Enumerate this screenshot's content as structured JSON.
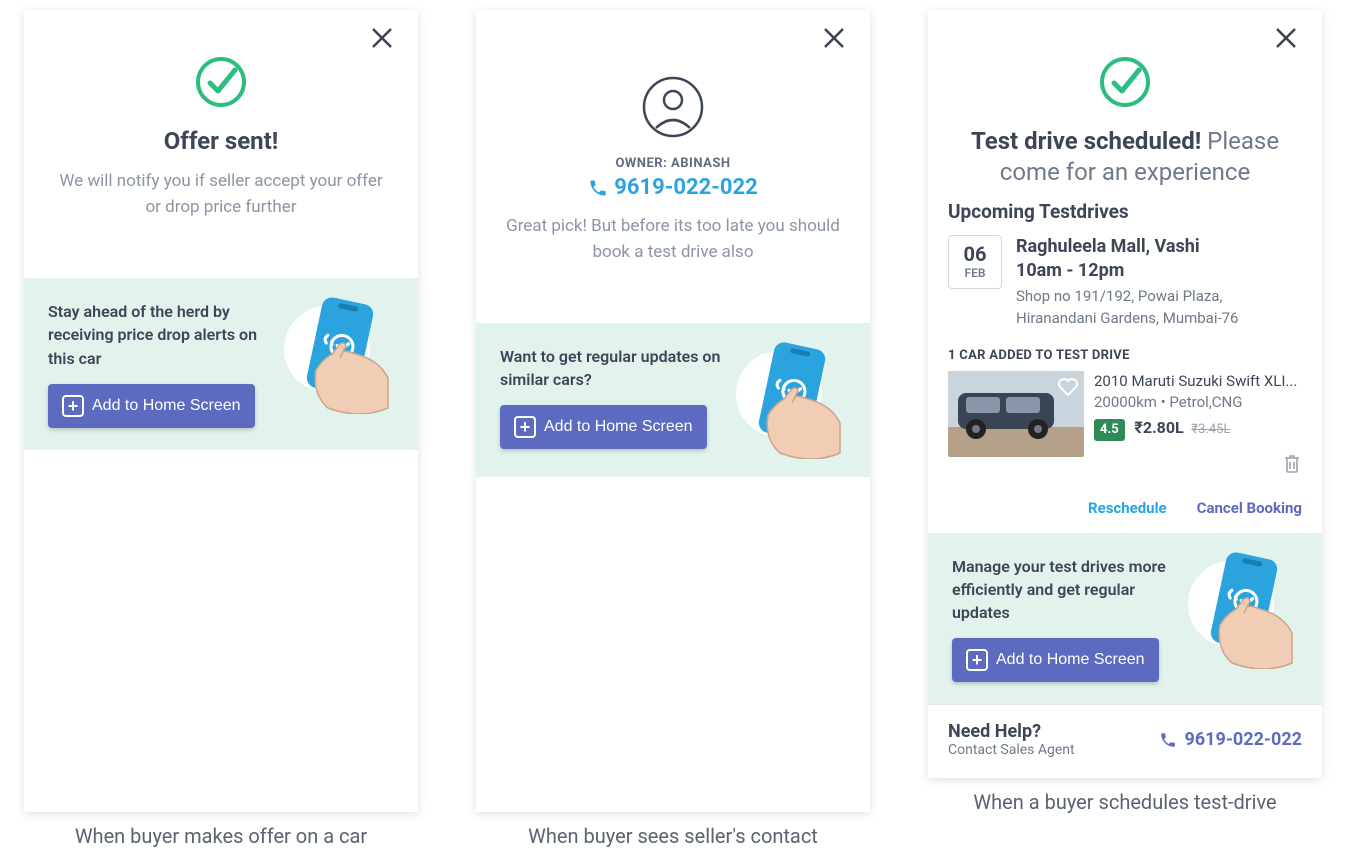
{
  "card1": {
    "title": "Offer sent!",
    "sub": "We will notify you if seller accept your offer or drop price further",
    "promo": "Stay ahead of the herd by receiving price drop alerts on this car",
    "btn": "Add to Home Screen",
    "caption": "When buyer makes offer on a car"
  },
  "card2": {
    "owner_label": "OWNER: ABINASH",
    "phone": "9619-022-022",
    "sub": "Great pick! But before its too late you should book a test drive also",
    "promo": "Want to get regular updates on similar cars?",
    "btn": "Add to Home Screen",
    "caption": "When buyer sees seller's contact"
  },
  "card3": {
    "title_bold": "Test drive scheduled!",
    "title_light": "Please come for an experience",
    "section": "Upcoming Testdrives",
    "date_day": "06",
    "date_mon": "FEB",
    "loc": "Raghuleela Mall, Vashi",
    "time": "10am - 12pm",
    "addr": "Shop no 191/192, Powai Plaza, Hiranandani Gardens, Mumbai-76",
    "count": "1 CAR ADDED TO TEST DRIVE",
    "car": {
      "name": "2010 Maruti Suzuki Swift XLI...",
      "meta": "20000km • Petrol,CNG",
      "rating": "4.5",
      "price": "₹2.80L",
      "strike": "₹3.45L"
    },
    "reschedule": "Reschedule",
    "cancel": "Cancel Booking",
    "promo": "Manage your test drives more efficiently and get regular updates",
    "btn": "Add to Home Screen",
    "help_h": "Need Help?",
    "help_s": "Contact Sales Agent",
    "help_phone": "9619-022-022",
    "caption": "When a buyer schedules test-drive"
  }
}
